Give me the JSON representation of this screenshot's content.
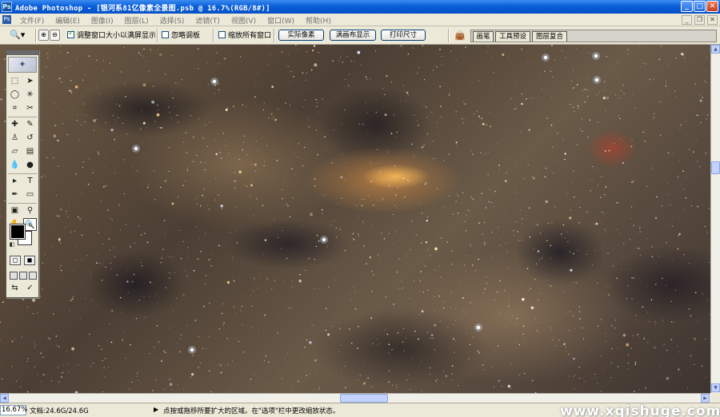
{
  "window": {
    "title": "Adobe Photoshop - [银河系81亿像素全景图.psb @ 16.7%(RGB/8#)]",
    "minimize_icon": "minimize-icon",
    "maximize_icon": "maximize-icon",
    "close_icon": "close-icon"
  },
  "menu": {
    "items": [
      "文件(F)",
      "编辑(E)",
      "图像(I)",
      "图层(L)",
      "选择(S)",
      "滤镜(T)",
      "视图(V)",
      "窗口(W)",
      "帮助(H)"
    ]
  },
  "options": {
    "tool_icon": "zoom-icon",
    "resize_windows_label": "调整窗口大小以满屏显示",
    "resize_windows_checked": true,
    "ignore_palettes_label": "忽略调板",
    "ignore_palettes_checked": false,
    "zoom_all_windows_label": "缩放所有窗口",
    "zoom_all_windows_checked": false,
    "actual_pixels_label": "实际像素",
    "fit_screen_label": "满画布显示",
    "print_size_label": "打印尺寸"
  },
  "palette_well": {
    "tabs": [
      "画笔",
      "工具预设",
      "图层复合"
    ]
  },
  "toolbox": {
    "tools": [
      "marquee-icon",
      "move-icon",
      "lasso-icon",
      "magic-wand-icon",
      "crop-icon",
      "slice-icon",
      "healing-brush-icon",
      "brush-icon",
      "clone-stamp-icon",
      "history-brush-icon",
      "eraser-icon",
      "gradient-icon",
      "blur-icon",
      "dodge-icon",
      "path-selection-icon",
      "type-icon",
      "pen-icon",
      "shape-icon",
      "notes-icon",
      "eyedropper-icon",
      "hand-icon",
      "zoom-tool-icon"
    ],
    "foreground_color": "#000000",
    "background_color": "#ffffff"
  },
  "status": {
    "zoom": "16.67%",
    "doc_info": "文档:24.6G/24.6G",
    "hint": "点按或拖移所要扩大的区域。在\"选项\"栏中更改缩放状态。"
  },
  "watermark": "www.xqishuge.com",
  "colors": {
    "title_bar": "#0a5fd8",
    "chrome": "#ece9d8",
    "nebula": "#f4a040"
  }
}
